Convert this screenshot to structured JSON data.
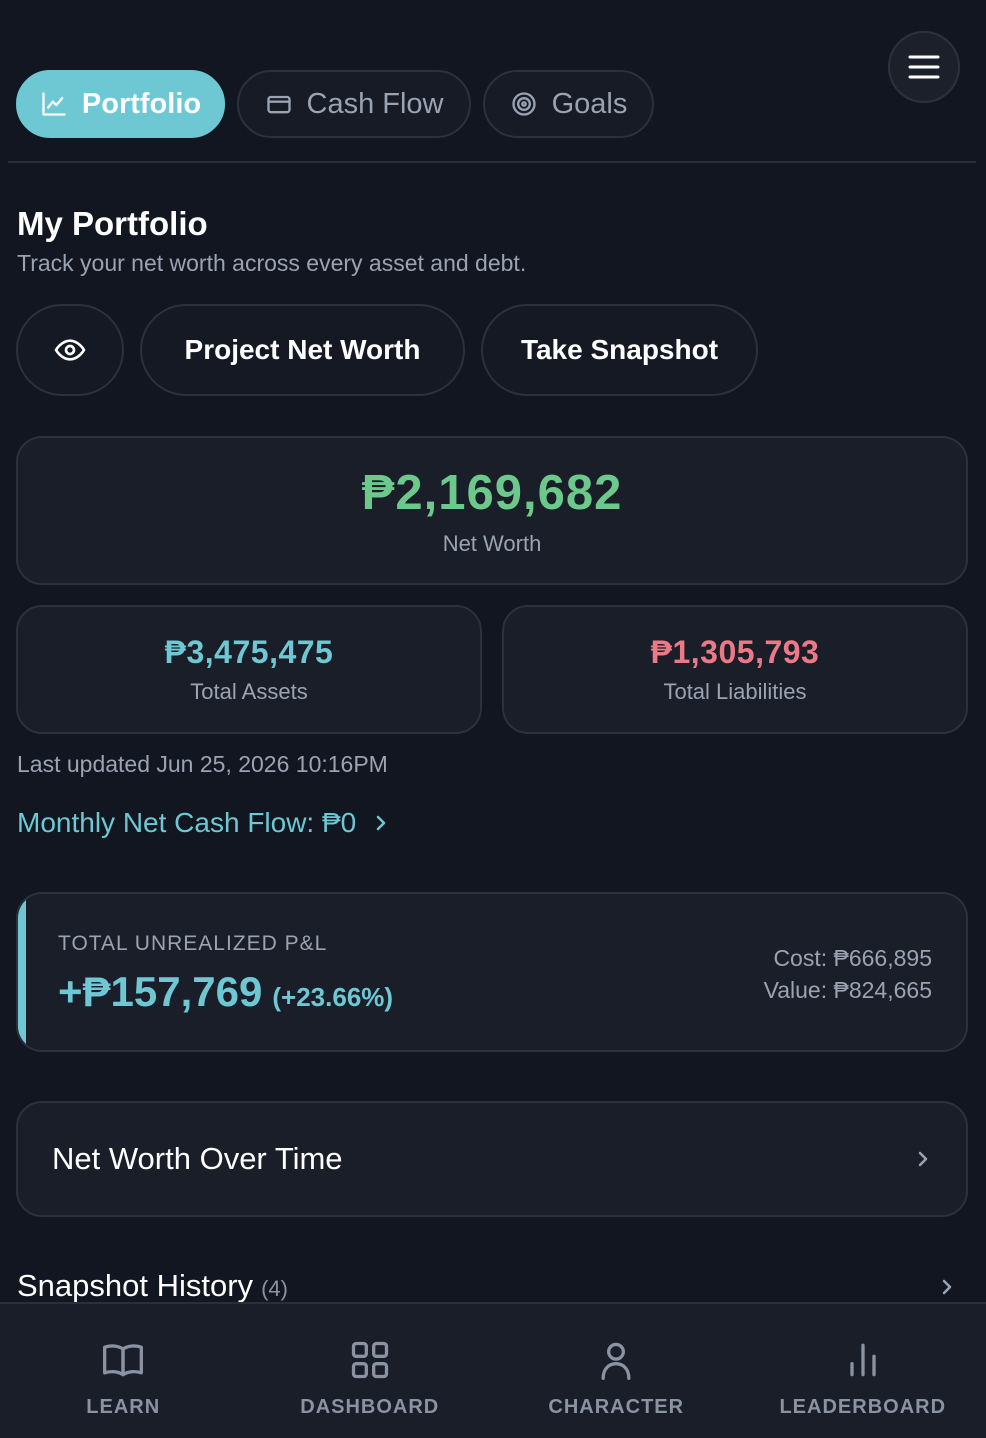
{
  "tabs": [
    {
      "label": "Portfolio",
      "icon": "chart-line-icon",
      "active": true
    },
    {
      "label": "Cash Flow",
      "icon": "card-icon",
      "active": false
    },
    {
      "label": "Goals",
      "icon": "target-icon",
      "active": false
    }
  ],
  "menu_icon": "hamburger-menu-icon",
  "header": {
    "title": "My Portfolio",
    "subtitle": "Track your net worth across every asset and debt."
  },
  "actions": {
    "visibility_icon": "eye-icon",
    "project_label": "Project Net Worth",
    "snapshot_label": "Take Snapshot"
  },
  "net_worth": {
    "value": "₱2,169,682",
    "label": "Net Worth",
    "color": "#6dc98b"
  },
  "assets": {
    "value": "₱3,475,475",
    "label": "Total Assets",
    "color": "#6ec8d4"
  },
  "liabilities": {
    "value": "₱1,305,793",
    "label": "Total Liabilities",
    "color": "#ec7a86"
  },
  "last_updated": "Last updated Jun 25, 2026 10:16PM",
  "cash_flow_link": "Monthly Net Cash Flow: ₱0",
  "unrealized": {
    "label": "TOTAL UNREALIZED P&L",
    "value": "+₱157,769",
    "percent": "(+23.66%)",
    "cost": "Cost: ₱666,895",
    "market_value": "Value: ₱824,665"
  },
  "net_worth_over_time": "Net Worth Over Time",
  "snapshot_history": {
    "title": "Snapshot History",
    "count": "(4)"
  },
  "bottom_nav": [
    {
      "label": "LEARN",
      "icon": "book-icon"
    },
    {
      "label": "DASHBOARD",
      "icon": "grid-icon"
    },
    {
      "label": "CHARACTER",
      "icon": "person-icon"
    },
    {
      "label": "LEADERBOARD",
      "icon": "bar-chart-icon"
    }
  ],
  "colors": {
    "accent": "#6ec8d4",
    "positive": "#6dc98b",
    "negative": "#ec7a86",
    "background": "#121620"
  }
}
